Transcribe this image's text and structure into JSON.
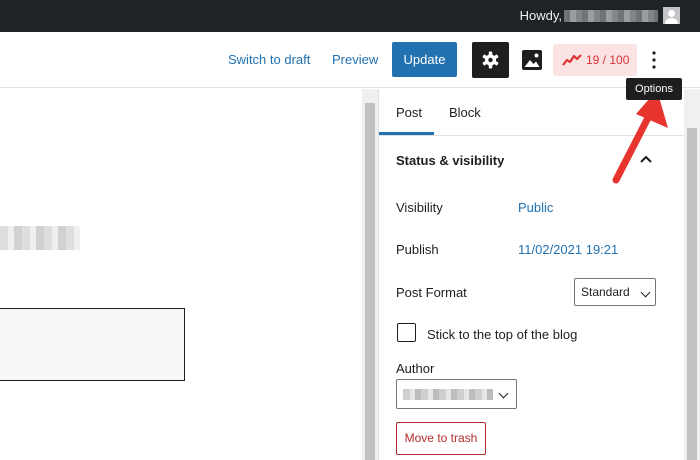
{
  "admin_bar": {
    "greeting": "Howdy,"
  },
  "header": {
    "switch_to_draft": "Switch to draft",
    "preview": "Preview",
    "update": "Update",
    "score": "19 / 100",
    "options_tooltip": "Options"
  },
  "sidebar": {
    "tabs": [
      {
        "label": "Post",
        "active": true
      },
      {
        "label": "Block",
        "active": false
      }
    ],
    "panel_title": "Status & visibility",
    "visibility_label": "Visibility",
    "visibility_value": "Public",
    "publish_label": "Publish",
    "publish_value": "11/02/2021 19:21",
    "post_format_label": "Post Format",
    "post_format_value": "Standard",
    "sticky_label": "Stick to the top of the blog",
    "sticky_checked": false,
    "author_label": "Author",
    "trash_label": "Move to trash"
  },
  "colors": {
    "accent": "#2271b1",
    "admin_bar": "#1d2327",
    "danger": "#b32d2e",
    "score_bg": "#fbe3e4",
    "annotation_arrow": "#e8342e"
  },
  "icons": [
    "gear-icon",
    "image-icon",
    "score-graph-icon",
    "vertical-ellipsis-icon",
    "chevron-up-icon",
    "chevron-down-icon",
    "avatar-icon"
  ]
}
